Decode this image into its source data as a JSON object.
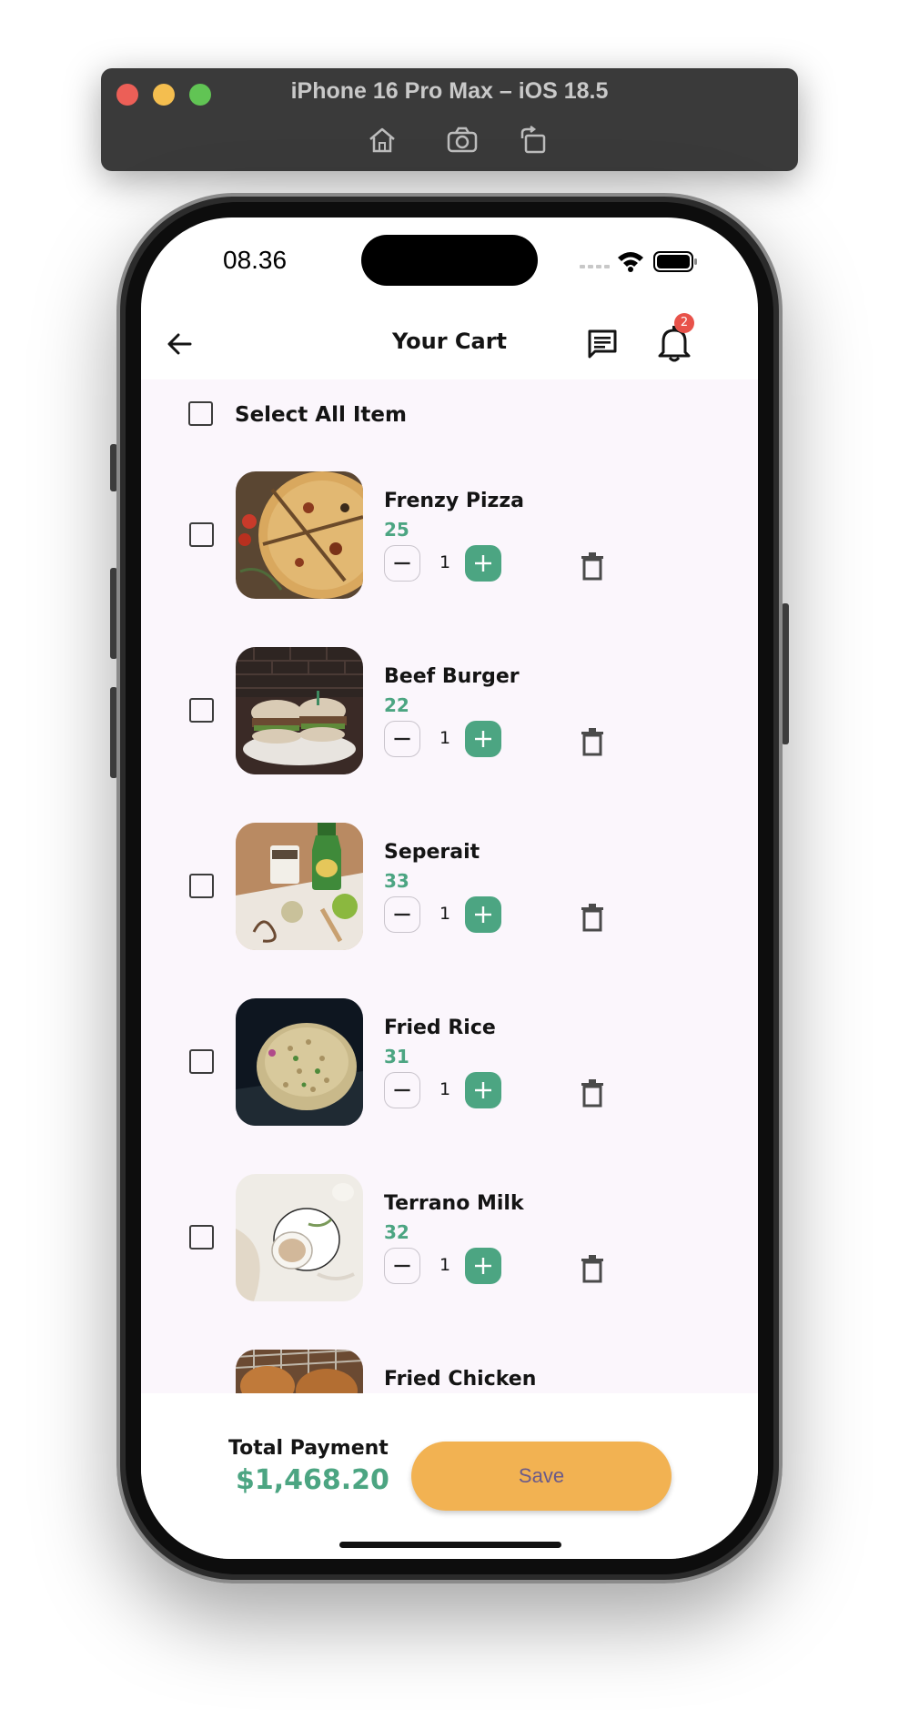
{
  "simulator": {
    "title": "iPhone 16 Pro Max – iOS 18.5",
    "tools": [
      "home-icon",
      "screenshot-icon",
      "rotate-icon"
    ]
  },
  "status_bar": {
    "time": "08.36"
  },
  "header": {
    "title": "Your Cart",
    "notification_count": "2"
  },
  "cart": {
    "select_all_label": "Select All Item",
    "items": [
      {
        "name": "Frenzy Pizza",
        "price": "25",
        "quantity": "1"
      },
      {
        "name": "Beef Burger",
        "price": "22",
        "quantity": "1"
      },
      {
        "name": "Seperait",
        "price": "33",
        "quantity": "1"
      },
      {
        "name": "Fried Rice",
        "price": "31",
        "quantity": "1"
      },
      {
        "name": "Terrano Milk",
        "price": "32",
        "quantity": "1"
      },
      {
        "name": "Fried Chicken"
      }
    ]
  },
  "footer": {
    "total_label": "Total Payment",
    "total_value": "$1,468.20",
    "save_label": "Save"
  },
  "colors": {
    "accent_green": "#4ca582",
    "save_button": "#f2b252",
    "badge": "#e8524a",
    "content_bg": "#fbf6fc"
  }
}
